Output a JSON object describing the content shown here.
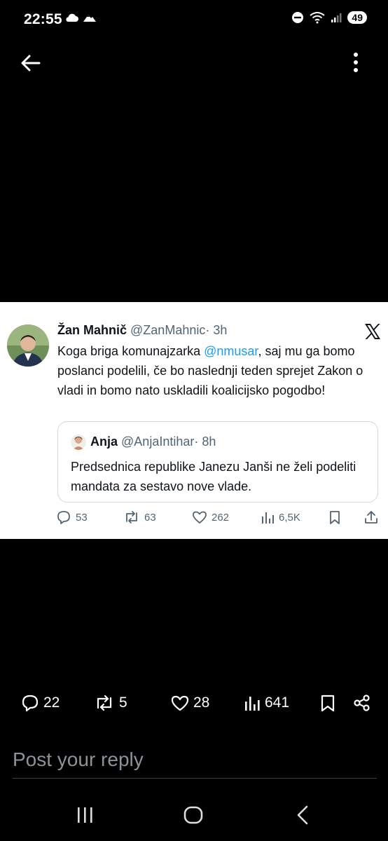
{
  "status_bar": {
    "time": "22:55",
    "battery": "49"
  },
  "tweet": {
    "author_name": "Žan Mahnič",
    "author_handle": "@ZanMahnic",
    "time": "· 3h",
    "text_before": "Koga briga komunajzarka ",
    "mention": "@nmusar",
    "text_after": ", saj mu ga bomo poslanci podelili, če bo naslednji teden sprejet Zakon o vladi in bomo nato uskladili koalicijsko pogodbo!",
    "quote": {
      "author_name": "Anja",
      "author_handle": "@AnjaIntihar",
      "time": "· 8h",
      "text": "Predsednica republike Janezu Janši ne želi podeliti mandata za sestavo nove vlade."
    },
    "actions": {
      "replies": "53",
      "reposts": "63",
      "likes": "262",
      "views": "6,5K"
    }
  },
  "post_actions": {
    "replies": "22",
    "reposts": "5",
    "likes": "28",
    "views": "641"
  },
  "reply_placeholder": "Post your reply",
  "colors": {
    "accent": "#1d9bf0",
    "background": "#000000",
    "card": "#ffffff"
  }
}
